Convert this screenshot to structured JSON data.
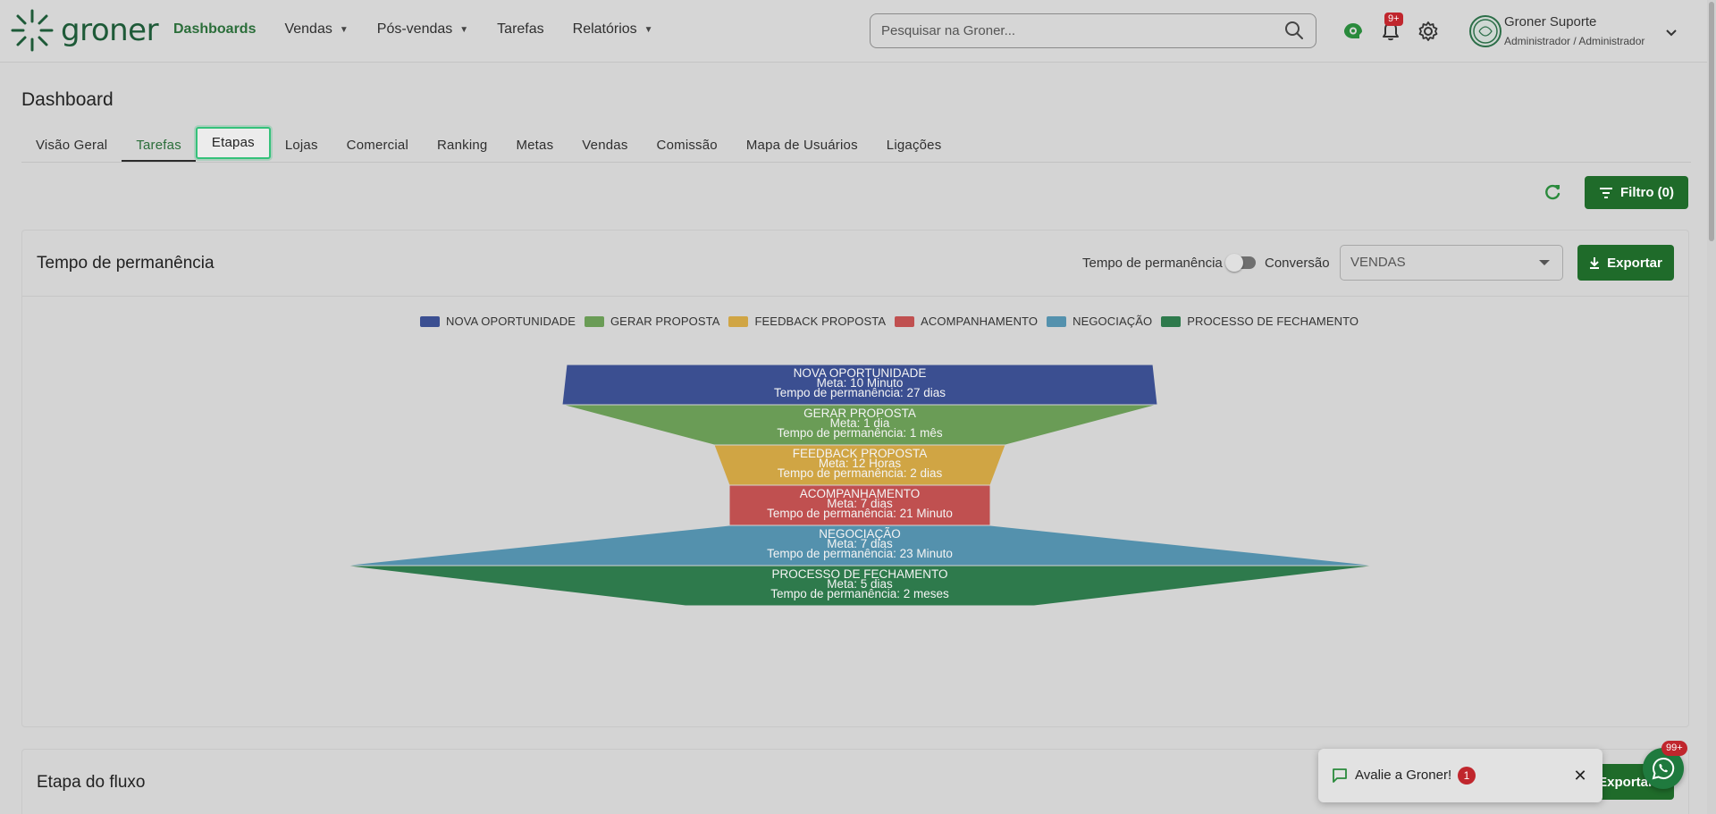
{
  "header": {
    "logo_text": "groner",
    "nav": [
      {
        "label": "Dashboards",
        "dropdown": false
      },
      {
        "label": "Vendas",
        "dropdown": true
      },
      {
        "label": "Pós-vendas",
        "dropdown": true
      },
      {
        "label": "Tarefas",
        "dropdown": false
      },
      {
        "label": "Relatórios",
        "dropdown": true
      }
    ],
    "search_placeholder": "Pesquisar na Groner...",
    "notifications_badge": "9+",
    "user_name": "Groner Suporte",
    "user_role": "Administrador / Administrador",
    "brand_color": "#1e5a38"
  },
  "page": {
    "title": "Dashboard",
    "tabs": [
      "Visão Geral",
      "Tarefas",
      "Etapas",
      "Lojas",
      "Comercial",
      "Ranking",
      "Metas",
      "Vendas",
      "Comissão",
      "Mapa de Usuários",
      "Ligações"
    ],
    "filter_label": "Filtro (0)"
  },
  "card": {
    "title": "Tempo de permanência",
    "toggle_left": "Tempo de permanência",
    "toggle_right": "Conversão",
    "select_value": "VENDAS",
    "export_label": "Exportar"
  },
  "chart_data": {
    "type": "funnel",
    "legend_position": "top-center",
    "legend": [
      "NOVA OPORTUNIDADE",
      "GERAR PROPOSTA",
      "FEEDBACK PROPOSTA",
      "ACOMPANHAMENTO",
      "NEGOCIAÇÃO",
      "PROCESSO DE FECHAMENTO"
    ],
    "stages": [
      {
        "name": "NOVA OPORTUNIDADE",
        "meta": "Meta: 10 Minuto",
        "permanencia": "Tempo de permanência: 27 dias",
        "color": "#3b4f91"
      },
      {
        "name": "GERAR PROPOSTA",
        "meta": "Meta: 1 dia",
        "permanencia": "Tempo de permanência: 1 mês",
        "color": "#6a9c56"
      },
      {
        "name": "FEEDBACK PROPOSTA",
        "meta": "Meta: 12 Horas",
        "permanencia": "Tempo de permanência: 2 dias",
        "color": "#d0a544"
      },
      {
        "name": "ACOMPANHAMENTO",
        "meta": "Meta: 7 dias",
        "permanencia": "Tempo de permanência: 21 Minuto",
        "color": "#c05050"
      },
      {
        "name": "NEGOCIAÇÃO",
        "meta": "Meta: 7 dias",
        "permanencia": "Tempo de permanência: 23 Minuto",
        "color": "#5491ad"
      },
      {
        "name": "PROCESSO DE FECHAMENTO",
        "meta": "Meta: 5 dias",
        "permanencia": "Tempo de permanência: 2 meses",
        "color": "#2e7a4c"
      }
    ]
  },
  "card2": {
    "title": "Etapa do fluxo",
    "export_label": "Exportar"
  },
  "toast": {
    "text": "Avalie a Groner!",
    "badge": "1"
  },
  "whatsapp_badge": "99+"
}
